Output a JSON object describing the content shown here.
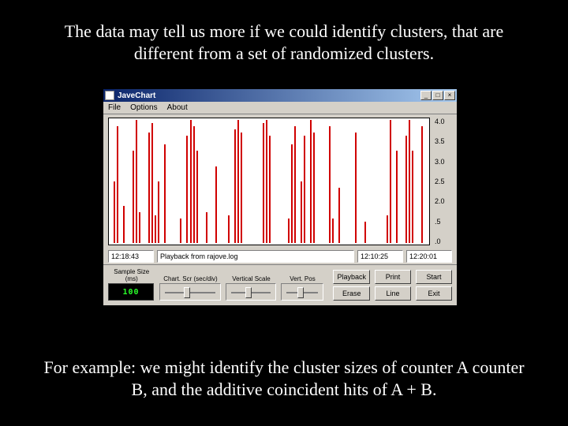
{
  "slide": {
    "top_text": "The data may tell us more if we could identify clusters, that are different from a set of randomized clusters.",
    "bottom_text": "For example: we might identify the cluster sizes of counter A counter B, and the additive coincident hits of A + B."
  },
  "window": {
    "title": "JaveChart",
    "win_min": "_",
    "win_max": "□",
    "win_close": "×",
    "menu": {
      "file": "File",
      "options": "Options",
      "about": "About"
    },
    "y_ticks": [
      "4.0",
      "3.5",
      "3.0",
      "2.5",
      "2.0",
      ".5",
      ".0"
    ]
  },
  "status": {
    "time_left": "12:18:43",
    "msg": "Playback from rajove.log",
    "time_mid": "12:10:25",
    "time_right": "12:20:01"
  },
  "controls": {
    "sample_label": "Sample Size (ms)",
    "sample_value": "100",
    "scroll_label": "Chart. Scr (sec/div)",
    "vscale_label": "Vertical Scale",
    "vpos_label": "Vert. Pos",
    "btn_playback": "Playback",
    "btn_print": "Print",
    "btn_start": "Start",
    "btn_erase": "Erase",
    "btn_line": "Line",
    "btn_exit": "Exit"
  },
  "chart_data": {
    "type": "bar",
    "title": "",
    "xlabel": "",
    "ylabel": "",
    "ylim": [
      0,
      4
    ],
    "categories_pct": [
      1,
      2,
      4,
      7,
      8,
      9,
      12,
      13,
      14,
      15,
      17,
      22,
      24,
      25,
      26,
      27,
      30,
      33,
      37,
      39,
      40,
      41,
      48,
      49,
      50,
      56,
      57,
      58,
      60,
      61,
      63,
      64,
      69,
      70,
      72,
      77,
      80,
      87,
      88,
      90,
      93,
      94,
      95,
      98
    ],
    "values": [
      2.0,
      3.8,
      1.2,
      3.0,
      4.0,
      1.0,
      3.6,
      3.9,
      0.9,
      2.0,
      3.2,
      0.8,
      3.5,
      4.0,
      3.8,
      3.0,
      1.0,
      2.5,
      0.9,
      3.7,
      4.0,
      3.6,
      3.9,
      4.0,
      3.5,
      0.8,
      3.2,
      3.8,
      2.0,
      3.5,
      4.0,
      3.6,
      3.8,
      0.8,
      1.8,
      3.6,
      0.7,
      0.9,
      4.0,
      3.0,
      3.5,
      4.0,
      3.0,
      3.8
    ]
  }
}
